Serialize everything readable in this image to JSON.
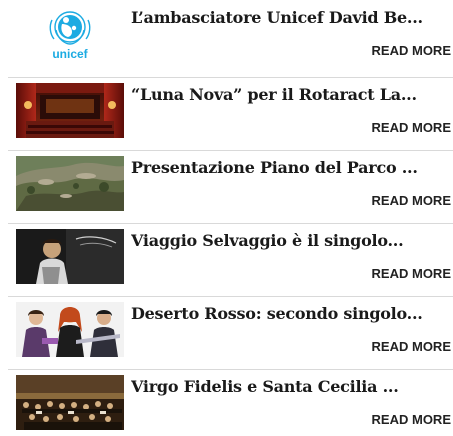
{
  "read_more_label": "READ MORE",
  "items": [
    {
      "title": "L’ambasciatore Unicef David Be...",
      "thumb_icon": "unicef-logo",
      "logo_text": "unicef"
    },
    {
      "title": "“Luna Nova” per il Rotaract La...",
      "thumb_icon": "theater-stage-photo"
    },
    {
      "title": "Presentazione Piano del Parco ...",
      "thumb_icon": "rocky-landscape-photo"
    },
    {
      "title": "Viaggio Selvaggio è il singolo...",
      "thumb_icon": "singer-album-cover-photo"
    },
    {
      "title": "Deserto Rosso: secondo singolo...",
      "thumb_icon": "band-photo"
    },
    {
      "title": "Virgo Fidelis e Santa Cecilia ...",
      "thumb_icon": "orchestra-concert-photo"
    }
  ],
  "colors": {
    "unicef_blue": "#1cabe2",
    "title_text": "#1a1a1a",
    "divider": "#d9d9d9"
  }
}
